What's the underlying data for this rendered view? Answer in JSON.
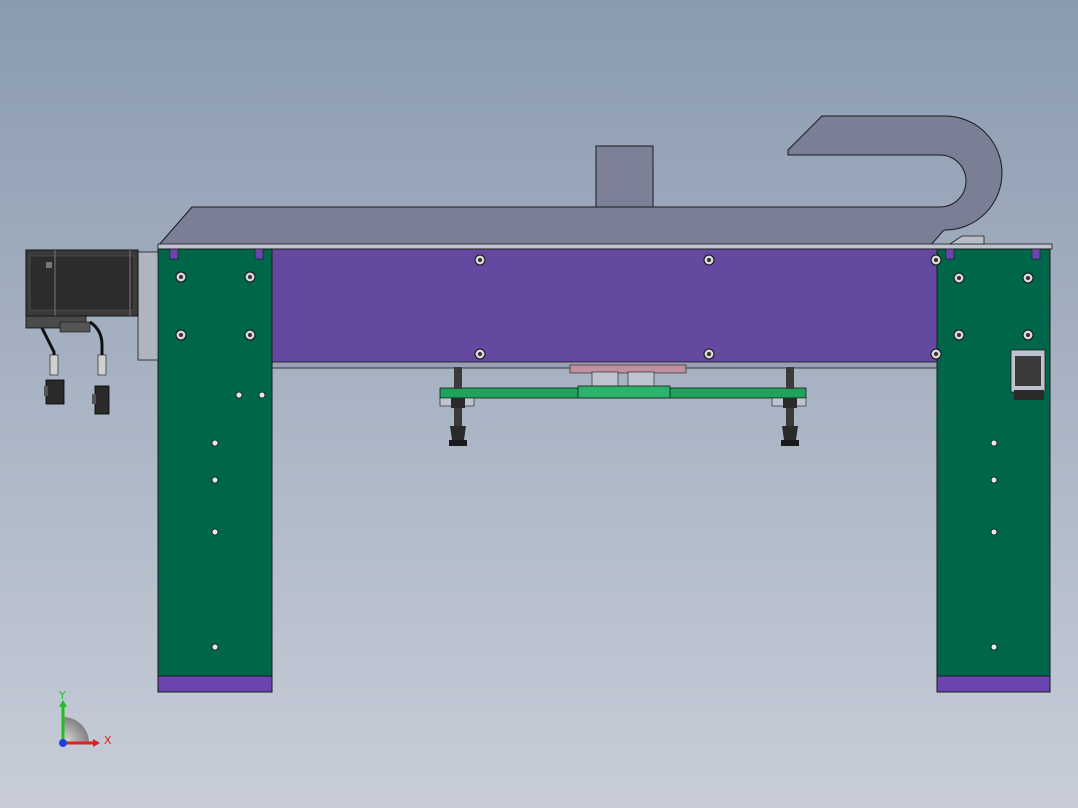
{
  "viewport": {
    "background_top": "#8a9bb0",
    "background_bottom": "#c8cdd8"
  },
  "colors": {
    "leg_green": "#00664a",
    "beam_purple": "#6548a0",
    "foot_purple": "#6a45b0",
    "cover_gray": "#7a7f96",
    "gripper_green": "#1fa25a",
    "motor_dark": "#3a3a3a",
    "edge": "#1a1a1a"
  },
  "triad": {
    "x_label": "X",
    "y_label": "Y",
    "x_color": "#e02020",
    "y_color": "#20c020",
    "z_color": "#2040e0"
  }
}
